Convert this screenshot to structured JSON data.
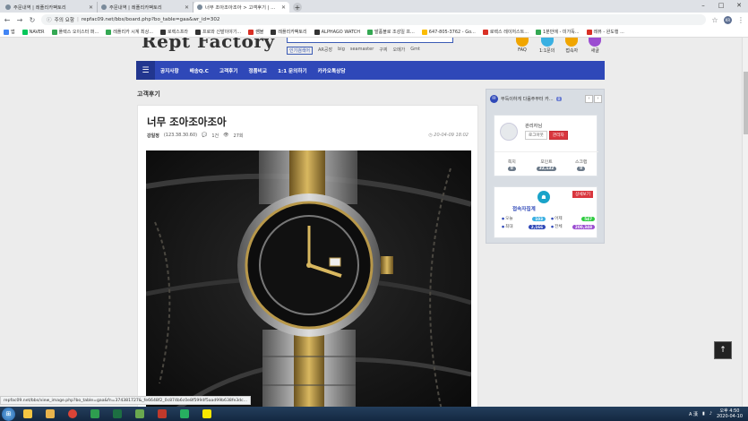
{
  "browser": {
    "tabs": [
      {
        "label": "주문내역 | 레플리카팩토리",
        "active": false
      },
      {
        "label": "주문내역 | 레플리카팩토리",
        "active": false
      },
      {
        "label": "너무 조아조아조아 > 고객후기 | 레...",
        "active": true
      }
    ],
    "new_tab": "+",
    "security_label": "주의 요함",
    "url": "repfac09.net/bbs/board.php?bo_table=gaa&wr_id=302",
    "profile_initials": "KR",
    "bookmarks": [
      {
        "label": "앱",
        "color": "#4285f4"
      },
      {
        "label": "NAVER",
        "color": "#03c75a"
      },
      {
        "label": "플렉스 오이스터 퍼...",
        "color": "#34a853"
      },
      {
        "label": "레플리카 시계 최상...",
        "color": "#34a853"
      },
      {
        "label": "로렉스프라",
        "color": "#333333"
      },
      {
        "label": "프로와 신발이야기...",
        "color": "#333333"
      },
      {
        "label": "쌤블",
        "color": "#d93025"
      },
      {
        "label": "레플리카팩토리",
        "color": "#333333"
      },
      {
        "label": "ALPHAGO WATCH",
        "color": "#333333"
      },
      {
        "label": "발품블로 조성일 프...",
        "color": "#34a853"
      },
      {
        "label": "647-805-3762 - Go...",
        "color": "#fbbc04"
      },
      {
        "label": "로렉스 레이저스트...",
        "color": "#d93025"
      },
      {
        "label": "1분만에 - 미가독...",
        "color": "#34a853"
      },
      {
        "label": "레뷰 - 완도행 ...",
        "color": "#d93025"
      }
    ]
  },
  "site": {
    "logo": "Rept Factory",
    "search_keywords": [
      "인기검색어",
      "AR공장",
      "big",
      "seamaster",
      "구찌",
      "오메가",
      "Gmt"
    ],
    "quick_links": [
      {
        "label": "FAQ",
        "color": "#f0a500"
      },
      {
        "label": "1:1문의",
        "color": "#3ab0e2"
      },
      {
        "label": "접속자",
        "color": "#f0a500"
      },
      {
        "label": "새글",
        "color": "#9b4dd1"
      }
    ],
    "menu": [
      "공지사항",
      "배송Q.C",
      "고객후기",
      "정품비교",
      "1:1 문의하기",
      "카카오톡상담"
    ],
    "breadcrumb": "고객후기"
  },
  "post": {
    "title": "너무 조아조아조아",
    "author": "강일정",
    "ip": "(123.38.30.60)",
    "comments": "1건",
    "views": "27회",
    "date": "20-04-09 18:02"
  },
  "sidebar": {
    "notice": "부득이하게 다음주부터 카...",
    "notice_count": "0",
    "profile": {
      "name": "관리자님",
      "logout_label": "로그아웃",
      "admin_label": "관리자"
    },
    "stats": [
      {
        "label": "쪽지",
        "value": "0"
      },
      {
        "label": "포인트",
        "value": "32,132"
      },
      {
        "label": "스크랩",
        "value": "0"
      }
    ],
    "visitor": {
      "title": "접속자집계",
      "detail_label": "상세보기",
      "items": [
        {
          "label": "오늘",
          "value": "103",
          "color": "#3ab0e2"
        },
        {
          "label": "어제",
          "value": "547",
          "color": "#2ecc40"
        },
        {
          "label": "최대",
          "value": "2,166",
          "color": "#2f48b8"
        },
        {
          "label": "전체",
          "value": "200,348",
          "color": "#9b4dd1"
        }
      ]
    }
  },
  "status_url": "repfac09.net/bbs/view_image.php?bo_table=gaa&fn=374381727&_fe6648f2_0c874b6c0e8f5994f5aad99b638fe3dc...",
  "top_button": "↑",
  "taskbar": {
    "lang": "A 漢",
    "time": "오후 4:50",
    "date": "2020-04-10"
  }
}
